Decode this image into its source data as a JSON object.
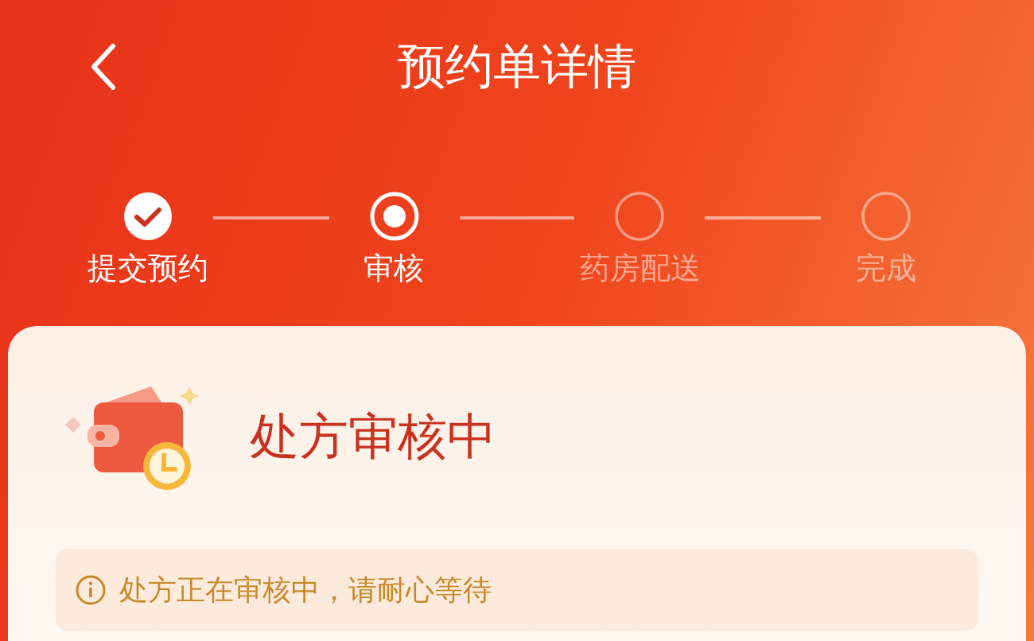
{
  "header": {
    "title": "预约单详情"
  },
  "steps": [
    {
      "label": "提交预约",
      "kind": "done"
    },
    {
      "label": "审核",
      "kind": "current"
    },
    {
      "label": "药房配送",
      "kind": "pending"
    },
    {
      "label": "完成",
      "kind": "pending"
    }
  ],
  "card": {
    "title": "处方审核中",
    "notice": "处方正在审核中，请耐心等待"
  }
}
